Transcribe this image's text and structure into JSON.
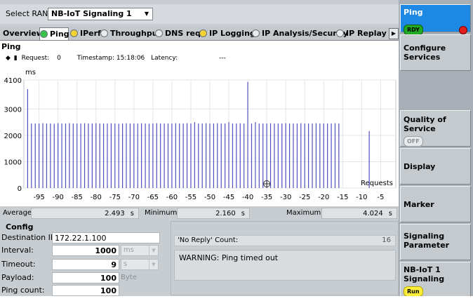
{
  "ran": {
    "label": "Select RAN:",
    "value": "NB-IoT Signaling 1"
  },
  "tabs": [
    {
      "label": "Overview",
      "dot": ""
    },
    {
      "label": "Ping",
      "dot": "#39c34a"
    },
    {
      "label": "IPerf",
      "dot": "#f2d335"
    },
    {
      "label": "Throughput",
      "dot": "#e8eaec"
    },
    {
      "label": "DNS req.",
      "dot": "#e8eaec"
    },
    {
      "label": "IP Logging",
      "dot": "#f2d335"
    },
    {
      "label": "IP Analysis/Security",
      "dot": "#e8eaec"
    },
    {
      "label": "IP Replay",
      "dot": "#e8eaec"
    }
  ],
  "panel": {
    "title": "Ping",
    "request_label": "Request:",
    "request_value": "0",
    "timestamp_label": "Timestamp:",
    "timestamp_value": "15:18:06",
    "latency_label": "Latency:",
    "latency_value": "---"
  },
  "chart_data": {
    "type": "bar",
    "ylabel": "ms",
    "xlabel": "Requests",
    "xlim": [
      -99,
      -1
    ],
    "ylim": [
      0,
      4100
    ],
    "xticks": [
      -95,
      -90,
      -85,
      -80,
      -75,
      -70,
      -65,
      -60,
      -55,
      -50,
      -45,
      -40,
      -35,
      -30,
      -25,
      -20,
      -15,
      -10,
      -5
    ],
    "yticks": [
      0,
      1000,
      2000,
      3000,
      4100
    ],
    "grid": true,
    "x": [
      -98,
      -97,
      -96,
      -95,
      -94,
      -93,
      -92,
      -91,
      -90,
      -89,
      -88,
      -87,
      -86,
      -85,
      -84,
      -83,
      -82,
      -81,
      -80,
      -79,
      -78,
      -77,
      -76,
      -75,
      -74,
      -73,
      -72,
      -71,
      -70,
      -69,
      -68,
      -67,
      -66,
      -65,
      -64,
      -63,
      -62,
      -61,
      -60,
      -59,
      -58,
      -57,
      -56,
      -55,
      -54,
      -53,
      -52,
      -51,
      -50,
      -49,
      -48,
      -47,
      -46,
      -45,
      -44,
      -43,
      -42,
      -41,
      -40,
      -39,
      -38,
      -37,
      -36,
      -35,
      -34,
      -33,
      -32,
      -31,
      -30,
      -29,
      -28,
      -27,
      -26,
      -25,
      -24,
      -23,
      -22,
      -21,
      -20,
      -19,
      -18,
      -17,
      -16,
      -15,
      -14,
      -13,
      -12,
      -11,
      -10,
      -9,
      -8
    ],
    "values": [
      3750,
      2450,
      2450,
      2450,
      2460,
      2450,
      2450,
      2440,
      2460,
      2450,
      2450,
      2460,
      2450,
      2450,
      2450,
      2460,
      2450,
      2450,
      2460,
      2450,
      2450,
      2450,
      2460,
      2450,
      2440,
      2450,
      2460,
      2450,
      2450,
      2450,
      2460,
      2450,
      2440,
      2450,
      2460,
      2450,
      2450,
      2450,
      2450,
      2460,
      2450,
      2450,
      2460,
      2450,
      2500,
      2450,
      2450,
      2460,
      2450,
      2450,
      2460,
      2450,
      2450,
      2500,
      2450,
      2450,
      2460,
      2450,
      4024,
      2450,
      2500,
      2450,
      2450,
      2450,
      2460,
      2450,
      2450,
      2450,
      2460,
      2450,
      2450,
      2450,
      2460,
      2450,
      2450,
      2450,
      2460,
      2450,
      2450,
      2450,
      2450,
      2460,
      2450,
      0,
      0,
      0,
      0,
      0,
      0,
      0,
      2160
    ],
    "bar_color": "#4f4fc0"
  },
  "stats": {
    "average_label": "Average:",
    "average_value": "2.493",
    "average_unit": "s",
    "minimum_label": "Minimum:",
    "minimum_value": "2.160",
    "minimum_unit": "s",
    "maximum_label": "Maximum:",
    "maximum_value": "4.024",
    "maximum_unit": "s"
  },
  "config": {
    "title": "Config",
    "destination_label": "Destination IP:",
    "destination_value": "172.22.1.100",
    "interval_label": "Interval:",
    "interval_value": "1000",
    "interval_unit": "ms",
    "timeout_label": "Timeout:",
    "timeout_value": "9",
    "timeout_unit": "s",
    "payload_label": "Payload:",
    "payload_value": "100",
    "payload_unit": "Byte",
    "count_label": "Ping count:",
    "count_value": "100"
  },
  "result": {
    "noreply_label": "'No Reply' Count:",
    "noreply_value": "16",
    "warning": "WARNING: Ping timed out"
  },
  "softkeys": {
    "ping": {
      "label": "Ping",
      "badge": "RDY"
    },
    "configure": {
      "label": "Configure Services"
    },
    "qos": {
      "label": "Quality of Service",
      "badge": "OFF"
    },
    "display": {
      "label": "Display"
    },
    "marker": {
      "label": "Marker"
    },
    "signaling_param": {
      "label": "Signaling Parameter"
    },
    "nbiot": {
      "label": "NB-IoT 1 Signaling",
      "badge": "Run"
    }
  }
}
